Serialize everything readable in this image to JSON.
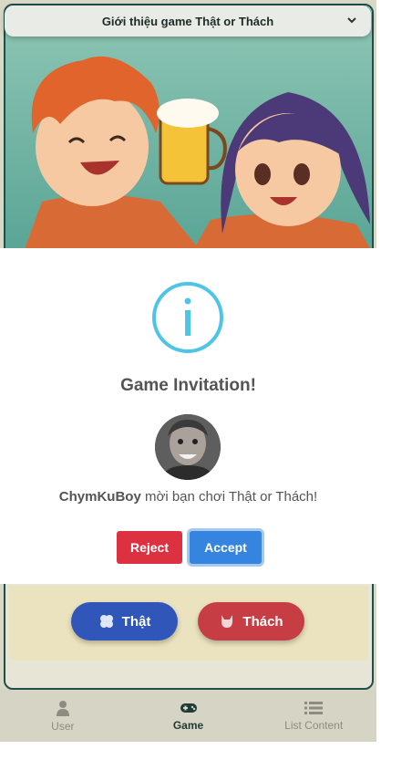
{
  "header": {
    "title": "Giới thiệu game Thật or Thách"
  },
  "game": {
    "truth_label": "Thật",
    "dare_label": "Thách"
  },
  "nav": {
    "items": [
      {
        "label": "User",
        "icon": "user-icon"
      },
      {
        "label": "Game",
        "icon": "gamepad-icon",
        "active": true
      },
      {
        "label": "List Content",
        "icon": "list-icon"
      }
    ]
  },
  "modal": {
    "title": "Game Invitation!",
    "inviter": "ChymKuBoy",
    "message": "mời bạn chơi Thật or Thách!",
    "reject_label": "Reject",
    "accept_label": "Accept",
    "icon": "info-icon"
  },
  "colors": {
    "info": "#4fc3e8",
    "reject": "#dc3140",
    "accept": "#3484e0",
    "truth": "#2f56b8",
    "dare": "#c63d44"
  }
}
